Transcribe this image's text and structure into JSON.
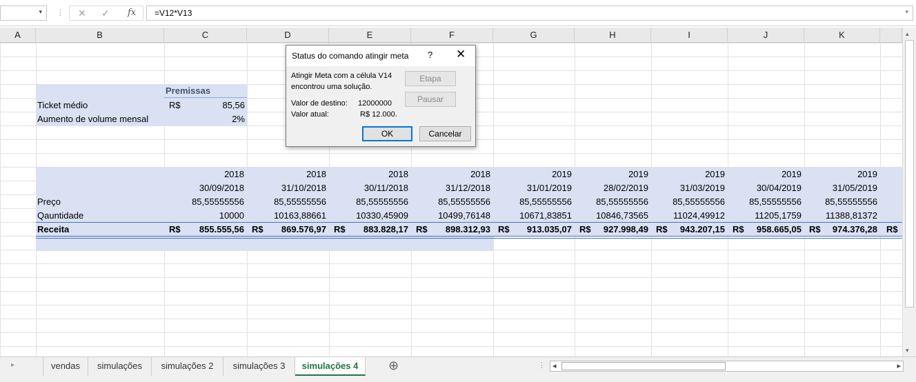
{
  "formula_bar": {
    "cell_value": "=V12*V13",
    "fx": "fx",
    "cancel_symbol": "✕",
    "enter_symbol": "✓",
    "dropdown": "▾"
  },
  "columns": [
    "A",
    "B",
    "C",
    "D",
    "E",
    "F",
    "G",
    "H",
    "I",
    "J",
    "K"
  ],
  "premissas": {
    "header": "Premissas",
    "ticket_label": "Ticket médio",
    "ticket_currency": "R$",
    "ticket_value": "85,56",
    "aumento_label": "Aumento de volume mensal",
    "aumento_value": "2%"
  },
  "table": {
    "years": [
      "2018",
      "2018",
      "2018",
      "2018",
      "2019",
      "2019",
      "2019",
      "2019",
      "2019"
    ],
    "dates": [
      "30/09/2018",
      "31/10/2018",
      "30/11/2018",
      "31/12/2018",
      "31/01/2019",
      "28/02/2019",
      "31/03/2019",
      "30/04/2019",
      "31/05/2019"
    ],
    "preco_label": "Preço",
    "preco": [
      "85,55555556",
      "85,55555556",
      "85,55555556",
      "85,55555556",
      "85,55555556",
      "85,55555556",
      "85,55555556",
      "85,55555556",
      "85,55555556"
    ],
    "quantidade_label": "Qauntidade",
    "quantidade": [
      "10000",
      "10163,88661",
      "10330,45909",
      "10499,76148",
      "10671,83851",
      "10846,73565",
      "11024,49912",
      "11205,1759",
      "11388,81372"
    ],
    "receita_label": "Receita",
    "currency": "R$",
    "receita": [
      "855.555,56",
      "869.576,97",
      "883.828,17",
      "898.312,93",
      "913.035,07",
      "927.998,49",
      "943.207,15",
      "958.665,05",
      "974.376,28"
    ]
  },
  "dialog": {
    "title": "Status do comando atingir meta",
    "help": "?",
    "close": "✕",
    "message_line1": "Atingir Meta com a célula V14",
    "message_line2": "encontrou uma solução.",
    "target_label": "Valor de destino:",
    "target_value": "12000000",
    "current_label": "Valor atual:",
    "current_value": "R$ 12.000.",
    "step_button": "Etapa",
    "pause_button": "Pausar",
    "ok_button": "OK",
    "cancel_button": "Cancelar"
  },
  "sheets": [
    "vendas",
    "simulações",
    "simulações 2",
    "simulações 3",
    "simulações 4"
  ],
  "active_sheet": "simulações 4",
  "accent_color": "#217346",
  "icons": {
    "add_sheet": "⊕",
    "scroll_prev": "◂",
    "scroll_next": "▸",
    "scroll_up": "▴",
    "scroll_down": "▾",
    "tab_nav": "▸"
  }
}
